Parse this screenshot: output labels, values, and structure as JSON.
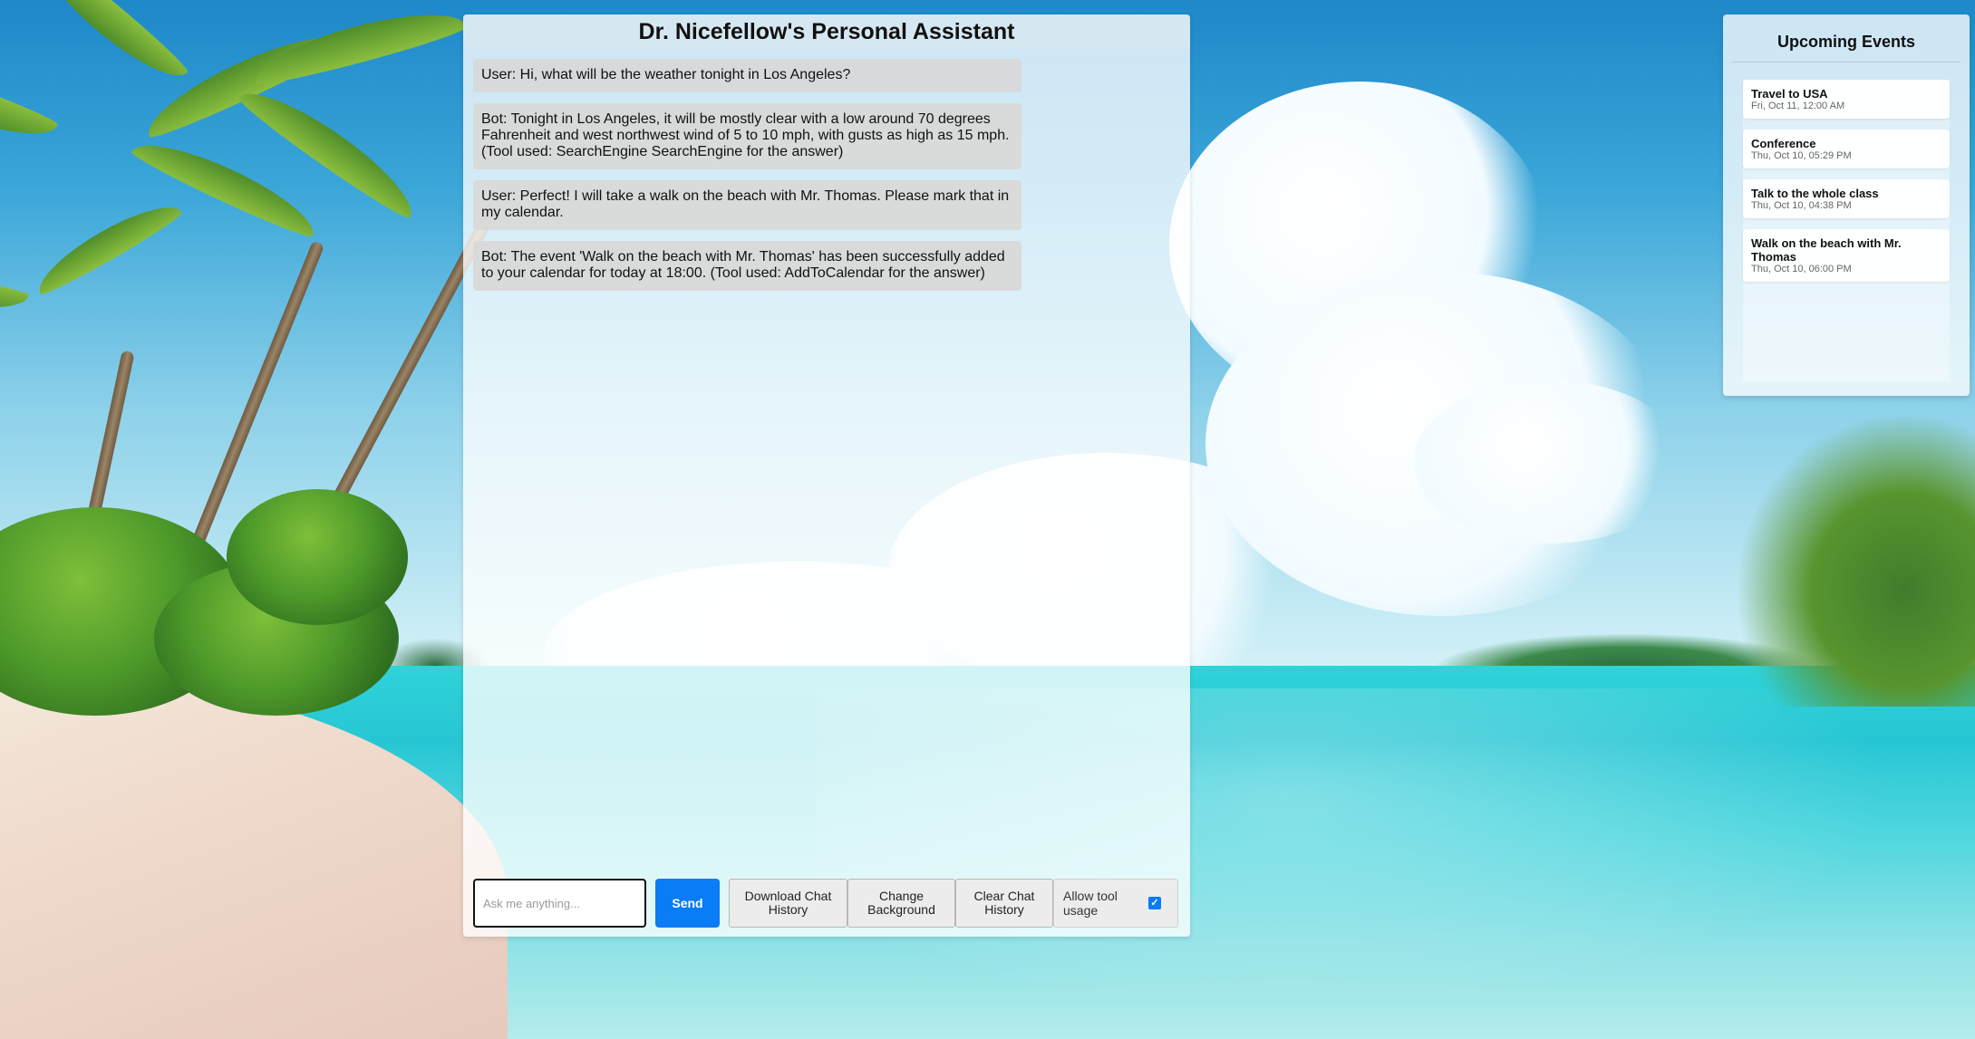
{
  "chat": {
    "title": "Dr. Nicefellow's Personal Assistant",
    "messages": [
      {
        "text": "User: Hi, what will be the weather tonight in Los Angeles?"
      },
      {
        "text": "Bot: Tonight in Los Angeles, it will be mostly clear with a low around 70 degrees Fahrenheit and west northwest wind of 5 to 10 mph, with gusts as high as 15 mph. (Tool used: SearchEngine SearchEngine for the answer)"
      },
      {
        "text": "User: Perfect! I will take a walk on the beach with Mr. Thomas. Please mark that in my calendar."
      },
      {
        "text": "Bot: The event 'Walk on the beach with Mr. Thomas' has been successfully added to your calendar for today at 18:00. (Tool used: AddToCalendar for the answer)"
      }
    ],
    "input": {
      "placeholder": "Ask me anything...",
      "value": ""
    },
    "send_label": "Send",
    "download_label": "Download Chat History",
    "change_background_label": "Change Background",
    "clear_label": "Clear Chat History",
    "allow_tool_label": "Allow tool usage",
    "allow_tool_checked": true
  },
  "events": {
    "title": "Upcoming Events",
    "items": [
      {
        "name": "Travel to USA",
        "time": "Fri, Oct 11, 12:00 AM"
      },
      {
        "name": "Conference",
        "time": "Thu, Oct 10, 05:29 PM"
      },
      {
        "name": "Talk to the whole class",
        "time": "Thu, Oct 10, 04:38 PM"
      },
      {
        "name": "Walk on the beach with Mr. Thomas",
        "time": "Thu, Oct 10, 06:00 PM"
      }
    ]
  },
  "colors": {
    "accent": "#0a7cf5",
    "message_bg": "#d8d8d8"
  }
}
